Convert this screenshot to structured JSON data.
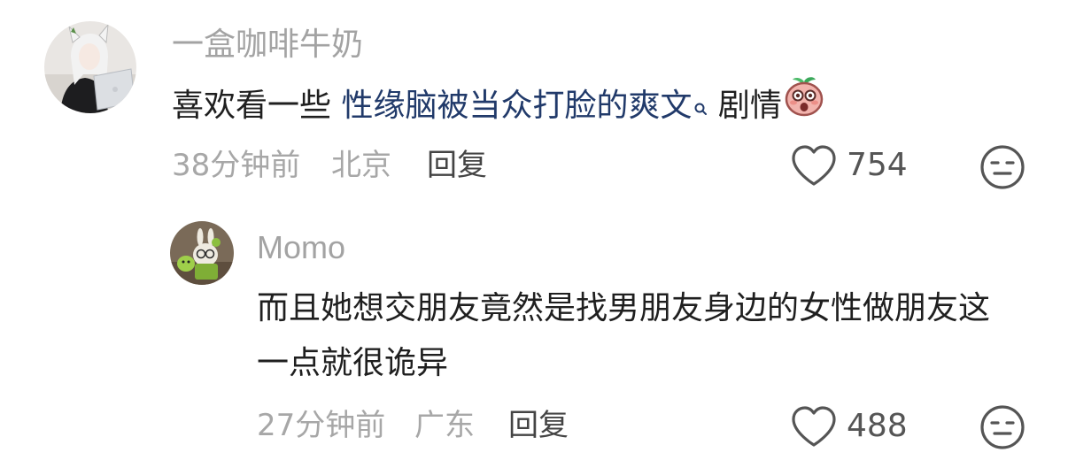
{
  "comments": [
    {
      "username": "一盒咖啡牛奶",
      "text_prefix": "喜欢看一些 ",
      "text_keyword": "性缘脑被当众打脸的爽文",
      "text_suffix": " 剧情",
      "time": "38分钟前",
      "location": "北京",
      "reply_label": "回复",
      "likes": "754"
    },
    {
      "username": "Momo",
      "text": "而且她想交朋友竟然是找男朋友身边的女性做朋友这一点就很诡异",
      "time": "27分钟前",
      "location": "广东",
      "reply_label": "回复",
      "likes": "488"
    }
  ],
  "colors": {
    "username": "#a3a3a3",
    "body_text": "#1f1f1f",
    "keyword": "#213a6a",
    "meta": "#a7a7a7"
  },
  "icons": {
    "like": "heart-outline-icon",
    "dislike": "expressionless-face-icon",
    "search_hint": "search-icon",
    "emoji": "peach-surprised-emoji"
  }
}
